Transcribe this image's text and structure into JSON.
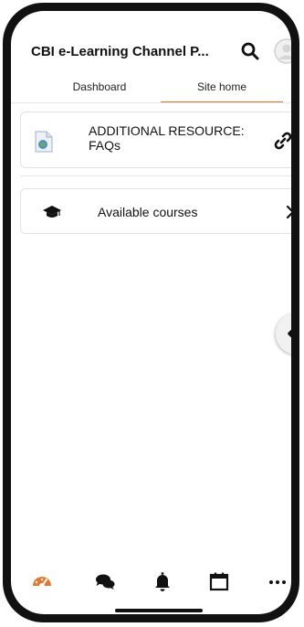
{
  "header": {
    "title": "CBI e-Learning Channel P...",
    "search_icon": "search-icon",
    "avatar_icon": "user-avatar-icon"
  },
  "tabs": [
    {
      "label": "Dashboard",
      "selected": false
    },
    {
      "label": "Site home",
      "selected": true
    }
  ],
  "resource": {
    "title": "ADDITIONAL RESOURCE: FAQs",
    "icon": "file-icon",
    "action_icon": "link-icon"
  },
  "courses": {
    "label": "Available courses",
    "icon": "graduation-cap-icon",
    "chevron": "chevron-right-icon"
  },
  "drawer_toggle": {
    "icon": "chevron-left-icon"
  },
  "bottom_nav": [
    {
      "icon": "dashboard-icon",
      "active": true
    },
    {
      "icon": "messages-icon",
      "active": false
    },
    {
      "icon": "bell-icon",
      "active": false
    },
    {
      "icon": "calendar-icon",
      "active": false
    },
    {
      "icon": "more-icon",
      "active": false
    }
  ],
  "colors": {
    "accent": "#e8772e",
    "text": "#111111",
    "divider": "#e6e6e6"
  }
}
